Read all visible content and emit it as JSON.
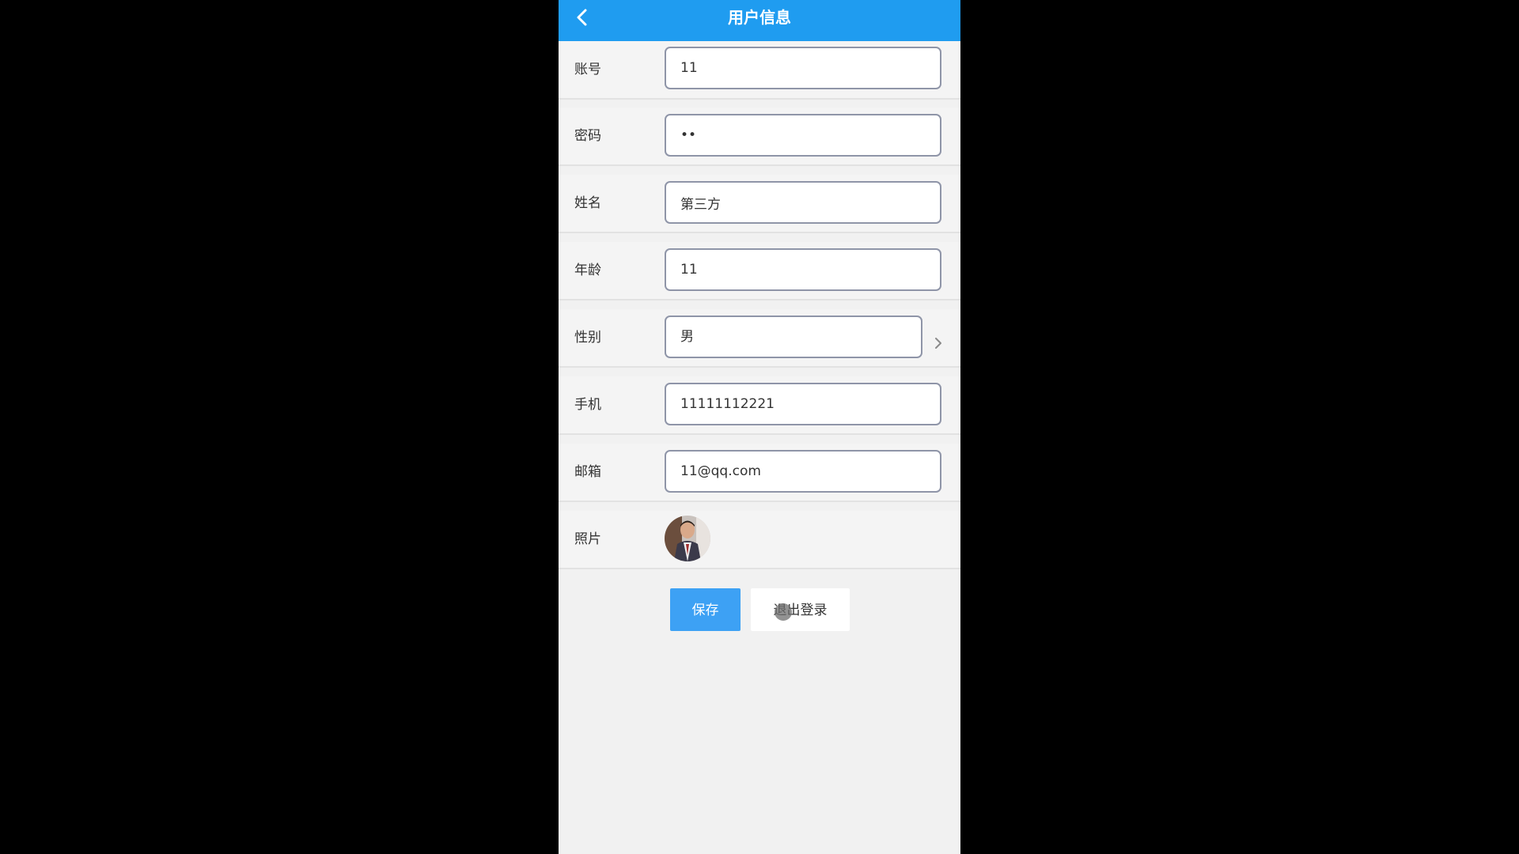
{
  "header": {
    "title": "用户信息",
    "back_icon": "chevron-left-icon"
  },
  "form": {
    "account": {
      "label": "账号",
      "value": "11"
    },
    "password": {
      "label": "密码",
      "value": "••"
    },
    "name": {
      "label": "姓名",
      "value": "第三方"
    },
    "age": {
      "label": "年龄",
      "value": "11"
    },
    "gender": {
      "label": "性别",
      "value": "男",
      "arrow_icon": "chevron-right-icon"
    },
    "phone": {
      "label": "手机",
      "value": "11111112221"
    },
    "email": {
      "label": "邮箱",
      "value": "11@qq.com"
    },
    "photo": {
      "label": "照片"
    }
  },
  "actions": {
    "save_label": "保存",
    "logout_label": "退出登录"
  },
  "colors": {
    "header_bg": "#1f9cf0",
    "save_bg": "#3da1f4",
    "page_bg": "#f1f1f1",
    "outer_bg": "#000000"
  }
}
